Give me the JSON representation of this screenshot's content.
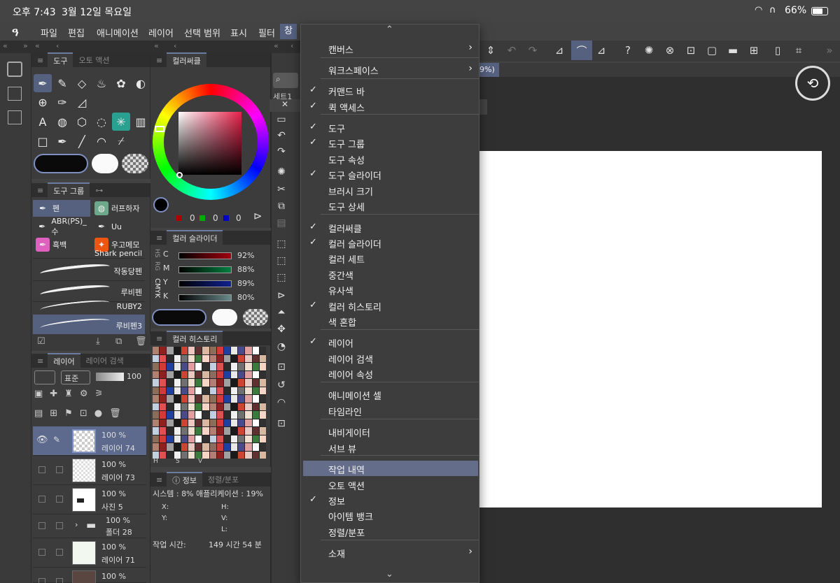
{
  "status": {
    "time": "오후 7:43",
    "date": "3월 12일 목요일",
    "battery": "66%"
  },
  "menu": [
    "파일",
    "편집",
    "애니메이션",
    "레이어",
    "선택 범위",
    "표시",
    "필터",
    "창"
  ],
  "tool_panel": {
    "tab_tool": "도구",
    "tab_auto": "오토 액션"
  },
  "color_circle": {
    "title": "컬러써클",
    "r": "0",
    "g": "0",
    "b": "0"
  },
  "color_slider": {
    "title": "컬러 슬라이더",
    "mode_tabs": [
      "HS",
      "RG",
      "CMYK"
    ],
    "rows": [
      {
        "label": "C",
        "value": "92%",
        "color": "#c00010"
      },
      {
        "label": "M",
        "value": "88%",
        "color": "#00a050"
      },
      {
        "label": "Y",
        "value": "89%",
        "color": "#1020c0"
      },
      {
        "label": "K",
        "value": "80%",
        "color": "#6a8a8a"
      }
    ]
  },
  "color_history": {
    "title": "컬러 히스토리",
    "bottom_labels": [
      "H",
      "S",
      "V"
    ]
  },
  "info": {
    "tab_info": "정보",
    "tab_align": "정렬/분포",
    "system_label": "시스템 :",
    "system_value": "8%",
    "app_label": "애플리케이션 :",
    "app_value": "19%",
    "x": "X:",
    "y": "Y:",
    "h": "H:",
    "v": "V:",
    "l": "L:",
    "work_time_label": "작업 시간:",
    "work_time_value": "149 시간 54 분"
  },
  "tool_group": {
    "tab": "도구 그룹",
    "items": [
      {
        "label": "펜",
        "icon_bg": "#566180"
      },
      {
        "label": "러프하자",
        "icon_bg": "#6ea88a"
      },
      {
        "label": "ABR(PS)_수",
        "icon_bg": "#3c3c3c"
      },
      {
        "label": "Uu",
        "icon_bg": "#3c3c3c"
      },
      {
        "label": "흑백",
        "icon_bg": "#e060c0"
      },
      {
        "label": "우고메모",
        "icon_bg": "#ee5511"
      }
    ],
    "brushes": [
      "Shark pencil",
      "작동당펜",
      "루비펜",
      "RUBY2",
      "루비펜3"
    ]
  },
  "layers": {
    "tab_layer": "레이어",
    "tab_search": "레이어 검색",
    "blend": "표준",
    "opacity": "100",
    "items": [
      {
        "pct": "100 %",
        "name": "레이어 74"
      },
      {
        "pct": "100 %",
        "name": "레이어 73"
      },
      {
        "pct": "100 %",
        "name": "사진 5"
      },
      {
        "pct": "100 %",
        "name": "폴더 28"
      },
      {
        "pct": "100 %",
        "name": "레이어 71"
      },
      {
        "pct": "100 %",
        "name": ""
      }
    ]
  },
  "canvas": {
    "zoom": "9%)",
    "sub_tab": "세트1"
  },
  "dropdown": {
    "up": "⌃",
    "down": "⌄",
    "items": [
      {
        "label": "캔버스",
        "checked": false,
        "submenu": true
      },
      {
        "label": "워크스페이스",
        "checked": false,
        "submenu": true
      },
      {
        "label": "커맨드 바",
        "checked": true
      },
      {
        "label": "퀵 액세스",
        "checked": true
      },
      {
        "label": "도구",
        "checked": true
      },
      {
        "label": "도구 그룹",
        "checked": true
      },
      {
        "label": "도구 속성",
        "checked": false
      },
      {
        "label": "도구 슬라이더",
        "checked": true
      },
      {
        "label": "브러시 크기",
        "checked": false
      },
      {
        "label": "도구 상세",
        "checked": false
      },
      {
        "label": "컬러써클",
        "checked": true
      },
      {
        "label": "컬러 슬라이더",
        "checked": true
      },
      {
        "label": "컬러 세트",
        "checked": false
      },
      {
        "label": "중간색",
        "checked": false
      },
      {
        "label": "유사색",
        "checked": false
      },
      {
        "label": "컬러 히스토리",
        "checked": true
      },
      {
        "label": "색 혼합",
        "checked": false
      },
      {
        "label": "레이어",
        "checked": true
      },
      {
        "label": "레이어 검색",
        "checked": false
      },
      {
        "label": "레이어 속성",
        "checked": false
      },
      {
        "label": "애니메이션 셀",
        "checked": false
      },
      {
        "label": "타임라인",
        "checked": false
      },
      {
        "label": "내비게이터",
        "checked": false
      },
      {
        "label": "서브 뷰",
        "checked": false
      },
      {
        "label": "작업 내역",
        "checked": false,
        "highlighted": true
      },
      {
        "label": "오토 액션",
        "checked": false
      },
      {
        "label": "정보",
        "checked": true
      },
      {
        "label": "아이템 뱅크",
        "checked": false
      },
      {
        "label": "정렬/분포",
        "checked": false
      },
      {
        "label": "소재",
        "checked": false,
        "submenu": true
      }
    ]
  },
  "colors": {
    "accent": "#566180",
    "highlight": "#646d8a",
    "canvas": "#ffffff",
    "menu_bg": "#3d3d3d"
  }
}
